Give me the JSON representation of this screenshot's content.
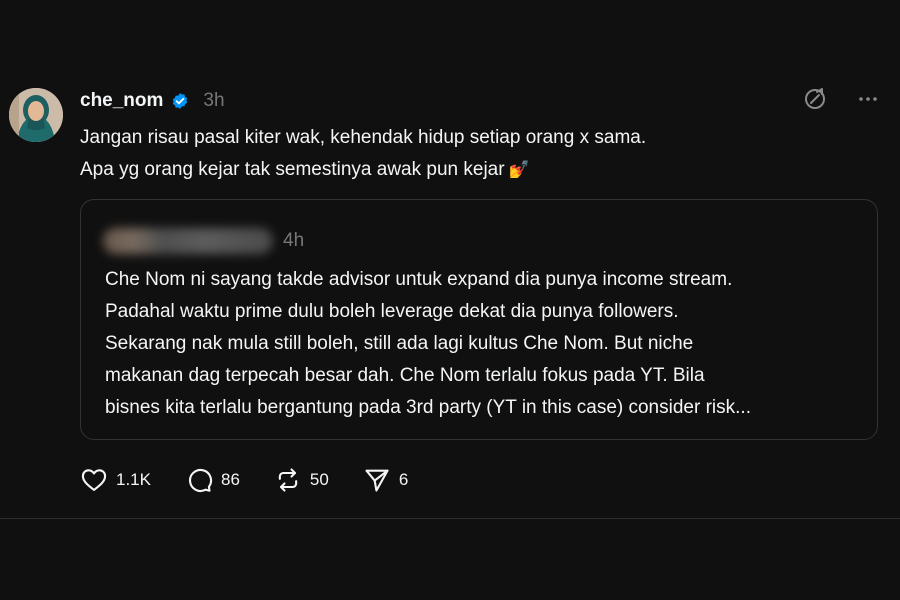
{
  "post": {
    "author": "che_nom",
    "time": "3h",
    "lines": [
      "Jangan risau pasal kiter wak, kehendak hidup setiap orang x sama.",
      "Apa yg orang kejar tak semestinya awak pun kejar"
    ],
    "emoji": "💅"
  },
  "quote": {
    "time": "4h",
    "lines": [
      "Che Nom ni sayang takde advisor untuk expand dia punya income stream.",
      "Padahal waktu prime dulu boleh leverage dekat dia punya followers.",
      "Sekarang nak mula still boleh, still ada lagi kultus Che Nom. But niche",
      "makanan dag terpecah besar dah. Che Nom terlalu fokus pada YT. Bila",
      "bisnes kita terlalu bergantung pada 3rd party (YT in this case) consider risk..."
    ]
  },
  "actions": {
    "likes": "1.1K",
    "replies": "86",
    "reposts": "50",
    "shares": "6"
  },
  "icons": {
    "verified": "verified-badge-icon",
    "top_left": "no-translate-icon",
    "top_right": "more-icon",
    "like": "heart-icon",
    "reply": "comment-icon",
    "repost": "repost-icon",
    "share": "send-icon"
  },
  "colors": {
    "background": "#101010",
    "text": "#f3f5f7",
    "muted": "#777777",
    "border": "#333333",
    "verified": "#0095f6"
  }
}
